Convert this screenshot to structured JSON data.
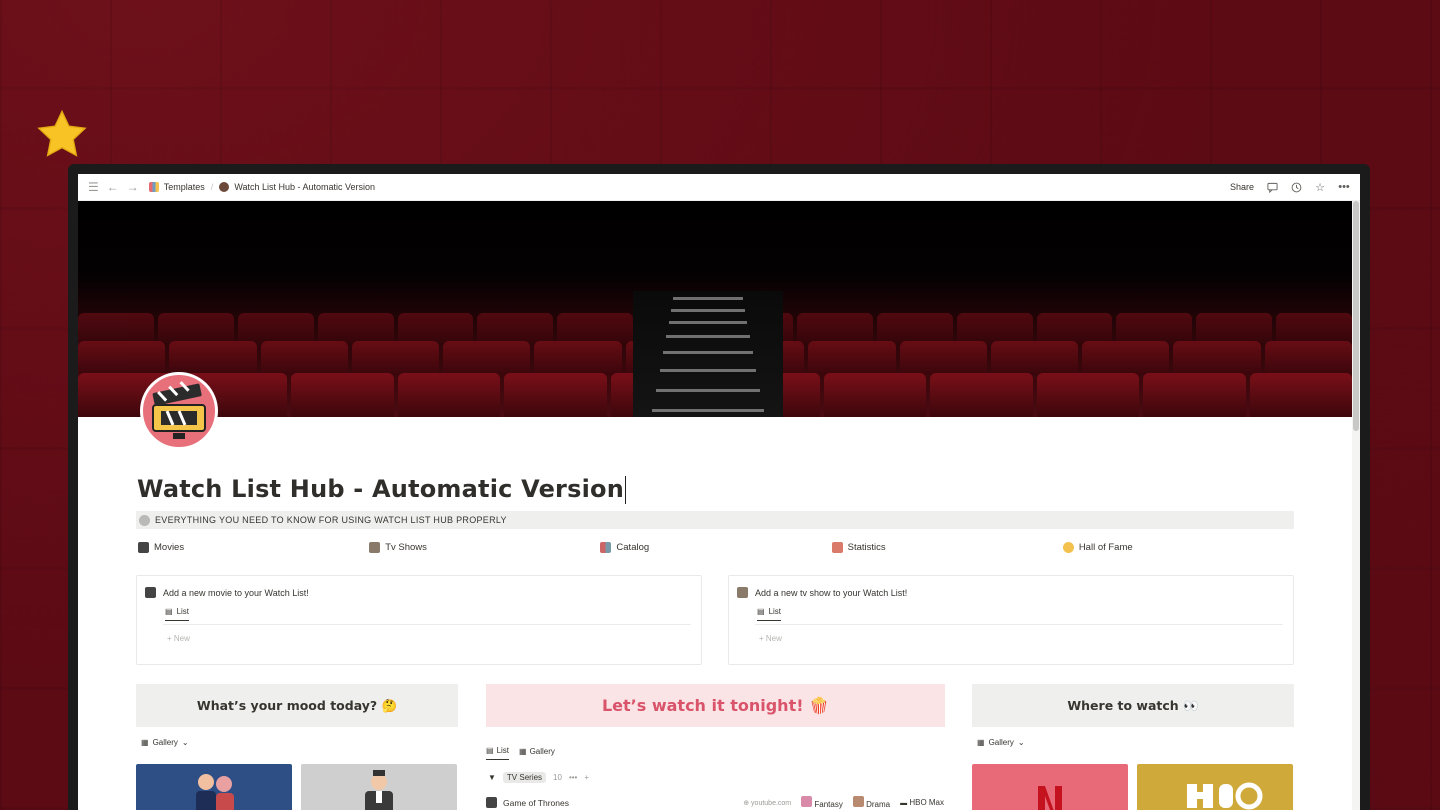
{
  "topbar": {
    "breadcrumbs": [
      "Templates",
      "Watch List Hub - Automatic Version"
    ],
    "share_label": "Share"
  },
  "page": {
    "title": "Watch List Hub - Automatic Version",
    "callout": "EVERYTHING YOU NEED TO KNOW FOR USING WATCH LIST HUB PROPERLY"
  },
  "nav_links": [
    {
      "label": "Movies",
      "icon": "clapperboard-icon"
    },
    {
      "label": "Tv Shows",
      "icon": "tv-icon"
    },
    {
      "label": "Catalog",
      "icon": "books-icon"
    },
    {
      "label": "Statistics",
      "icon": "chart-icon"
    },
    {
      "label": "Hall of Fame",
      "icon": "medal-icon"
    }
  ],
  "databases": {
    "movies": {
      "title": "Add a new movie to your Watch List!",
      "tab": "List",
      "new_label": "New"
    },
    "shows": {
      "title": "Add a new tv show to your Watch List!",
      "tab": "List",
      "new_label": "New"
    }
  },
  "panels": {
    "mood": {
      "title": "What’s your mood today? 🤔",
      "view": "Gallery"
    },
    "tonight": {
      "title": "Let’s watch it tonight! 🍿",
      "tabs": [
        "List",
        "Gallery"
      ]
    },
    "where": {
      "title": "Where to watch 👀",
      "view": "Gallery"
    }
  },
  "tonight_list": {
    "group": {
      "label": "TV Series",
      "count": "10"
    },
    "item": {
      "name": "Game of Thrones",
      "url": "youtube.com",
      "tags": [
        "Fantasy",
        "Drama",
        "HBO Max"
      ]
    }
  },
  "colors": {
    "background": "#5c0a14",
    "tonight_head_bg": "#fbe4e6",
    "tonight_head_text": "#d9546a",
    "netflix": "#e86a78",
    "hbo": "#cfa93a"
  }
}
